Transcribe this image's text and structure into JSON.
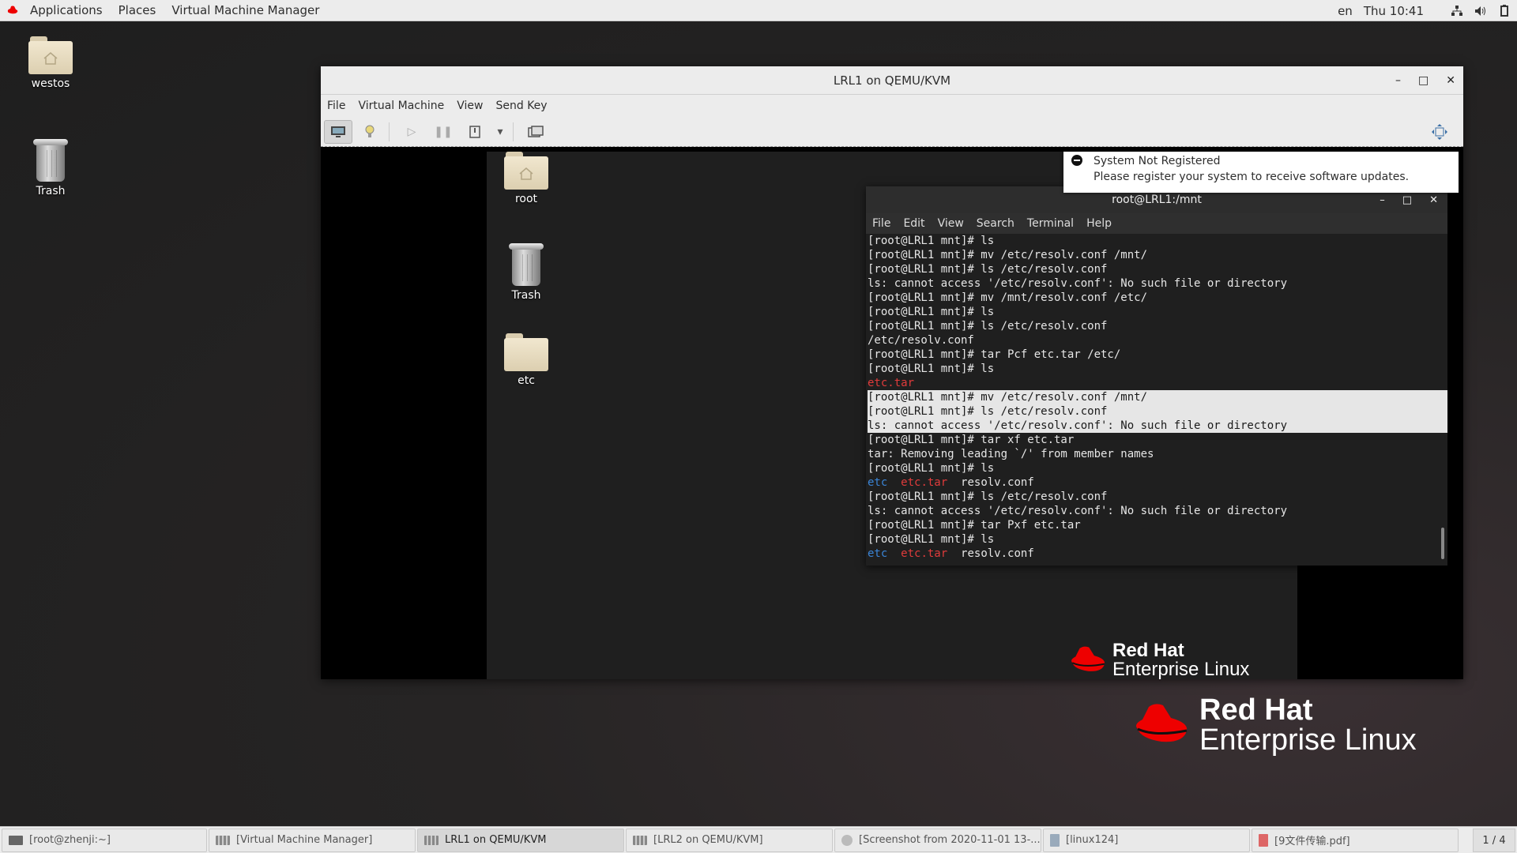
{
  "topbar": {
    "applications": "Applications",
    "places": "Places",
    "app_name": "Virtual Machine Manager",
    "lang": "en",
    "clock": "Thu 10:41"
  },
  "desktop": {
    "icons": [
      {
        "label": "westos"
      },
      {
        "label": "Trash"
      }
    ]
  },
  "vm_window": {
    "title": "LRL1 on QEMU/KVM",
    "menu": [
      "File",
      "Virtual Machine",
      "View",
      "Send Key"
    ]
  },
  "guest": {
    "icons": [
      {
        "label": "root"
      },
      {
        "label": "Trash"
      },
      {
        "label": "etc"
      }
    ],
    "notification": {
      "title": "System Not Registered",
      "body": "Please register your system to receive software updates."
    },
    "logo": {
      "line1": "Red Hat",
      "line2": "Enterprise Linux"
    }
  },
  "terminal": {
    "title": "root@LRL1:/mnt",
    "menu": [
      "File",
      "Edit",
      "View",
      "Search",
      "Terminal",
      "Help"
    ],
    "lines": [
      "[root@LRL1 mnt]# ls",
      "[root@LRL1 mnt]# mv /etc/resolv.conf /mnt/",
      "[root@LRL1 mnt]# ls /etc/resolv.conf",
      "ls: cannot access '/etc/resolv.conf': No such file or directory",
      "[root@LRL1 mnt]# mv /mnt/resolv.conf /etc/",
      "[root@LRL1 mnt]# ls",
      "[root@LRL1 mnt]# ls /etc/resolv.conf",
      "/etc/resolv.conf",
      "[root@LRL1 mnt]# tar Pcf etc.tar /etc/",
      "[root@LRL1 mnt]# ls",
      "etc.tar",
      "[root@LRL1 mnt]# mv /etc/resolv.conf /mnt/",
      "[root@LRL1 mnt]# ls /etc/resolv.conf",
      "ls: cannot access '/etc/resolv.conf': No such file or directory",
      "[root@LRL1 mnt]# tar xf etc.tar",
      "tar: Removing leading `/' from member names",
      "[root@LRL1 mnt]# ls",
      "etc",
      "etc.tar",
      "resolv.conf",
      "[root@LRL1 mnt]# ls /etc/resolv.conf",
      "ls: cannot access '/etc/resolv.conf': No such file or directory",
      "[root@LRL1 mnt]# tar Pxf etc.tar",
      "[root@LRL1 mnt]# ls",
      "etc",
      "etc.tar",
      "resolv.conf"
    ]
  },
  "host_logo": {
    "line1": "Red Hat",
    "line2": "Enterprise Linux"
  },
  "taskbar": {
    "items": [
      {
        "label": "[root@zhenji:~]"
      },
      {
        "label": "[Virtual Machine Manager]"
      },
      {
        "label": "LRL1 on QEMU/KVM"
      },
      {
        "label": "[LRL2 on QEMU/KVM]"
      },
      {
        "label": "[Screenshot from 2020-11-01 13-..."
      },
      {
        "label": "[linux124]"
      },
      {
        "label": "[9文件传输.pdf]"
      }
    ],
    "pager": "1 / 4"
  },
  "colors": {
    "accent_red": "#ee0000",
    "term_red": "#e03b3b",
    "term_blue": "#3a84d6"
  }
}
